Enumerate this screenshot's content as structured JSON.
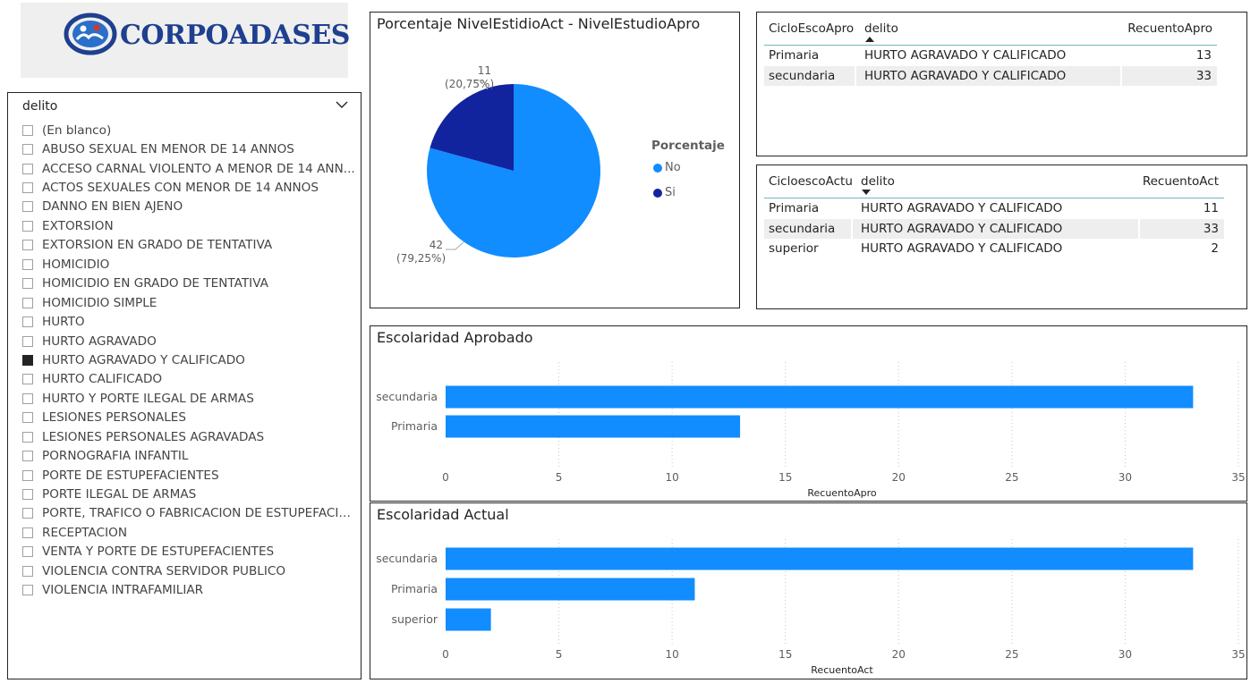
{
  "logo": {
    "text": "CORPOADASES"
  },
  "slicer": {
    "title": "delito",
    "items": [
      {
        "label": "(En blanco)",
        "selected": false
      },
      {
        "label": "ABUSO SEXUAL EN MENOR DE 14 ANNOS",
        "selected": false
      },
      {
        "label": "ACCESO CARNAL VIOLENTO A MENOR DE 14 ANN...",
        "selected": false
      },
      {
        "label": "ACTOS SEXUALES CON MENOR DE 14 ANNOS",
        "selected": false
      },
      {
        "label": "DANNO EN BIEN AJENO",
        "selected": false
      },
      {
        "label": "EXTORSION",
        "selected": false
      },
      {
        "label": "EXTORSION EN GRADO DE TENTATIVA",
        "selected": false
      },
      {
        "label": "HOMICIDIO",
        "selected": false
      },
      {
        "label": "HOMICIDIO EN GRADO DE TENTATIVA",
        "selected": false
      },
      {
        "label": "HOMICIDIO SIMPLE",
        "selected": false
      },
      {
        "label": "HURTO",
        "selected": false
      },
      {
        "label": "HURTO AGRAVADO",
        "selected": false
      },
      {
        "label": "HURTO AGRAVADO Y CALIFICADO",
        "selected": true
      },
      {
        "label": "HURTO CALIFICADO",
        "selected": false
      },
      {
        "label": "HURTO Y PORTE ILEGAL DE ARMAS",
        "selected": false
      },
      {
        "label": "LESIONES PERSONALES",
        "selected": false
      },
      {
        "label": "LESIONES PERSONALES AGRAVADAS",
        "selected": false
      },
      {
        "label": "PORNOGRAFIA INFANTIL",
        "selected": false
      },
      {
        "label": "PORTE DE ESTUPEFACIENTES",
        "selected": false
      },
      {
        "label": "PORTE ILEGAL DE ARMAS",
        "selected": false
      },
      {
        "label": "PORTE, TRAFICO O FABRICACION DE ESTUPEFACIEN...",
        "selected": false
      },
      {
        "label": "RECEPTACION",
        "selected": false
      },
      {
        "label": "VENTA Y PORTE DE ESTUPEFACIENTES",
        "selected": false
      },
      {
        "label": "VIOLENCIA CONTRA SERVIDOR PUBLICO",
        "selected": false
      },
      {
        "label": "VIOLENCIA INTRAFAMILIAR",
        "selected": false
      }
    ]
  },
  "table1": {
    "headers": [
      "CicloEscoApro",
      "delito",
      "RecuentoApro"
    ],
    "rows": [
      [
        "Primaria",
        "HURTO AGRAVADO Y CALIFICADO",
        "13"
      ],
      [
        "secundaria",
        "HURTO AGRAVADO Y CALIFICADO",
        "33"
      ]
    ]
  },
  "table2": {
    "headers": [
      "CicloescoActu",
      "delito",
      "RecuentoAct"
    ],
    "rows": [
      [
        "Primaria",
        "HURTO AGRAVADO Y CALIFICADO",
        "11"
      ],
      [
        "secundaria",
        "HURTO AGRAVADO Y CALIFICADO",
        "33"
      ],
      [
        "superior",
        "HURTO AGRAVADO Y CALIFICADO",
        "2"
      ]
    ]
  },
  "colors": {
    "light_blue": "#118dff",
    "dark_blue": "#12239e",
    "text": "#252423",
    "muted": "#605e5c"
  },
  "chart_data": [
    {
      "type": "pie",
      "title": "Porcentaje NivelEstidioAct - NivelEstudioApro",
      "legend_title": "Porcentaje",
      "legend_position": "right",
      "categories": [
        "No",
        "Si"
      ],
      "values": [
        42,
        11
      ],
      "data_labels": [
        "42",
        "(79,25%)",
        "11",
        "(20,75%)"
      ],
      "colors": [
        "#118dff",
        "#12239e"
      ]
    },
    {
      "type": "bar",
      "orientation": "horizontal",
      "title": "Escolaridad Aprobado",
      "categories": [
        "secundaria",
        "Primaria"
      ],
      "values": [
        33,
        13
      ],
      "xlabel": "RecuentoApro",
      "xlim": [
        0,
        35
      ],
      "ticks": [
        0,
        5,
        10,
        15,
        20,
        25,
        30,
        35
      ],
      "grid": true
    },
    {
      "type": "bar",
      "orientation": "horizontal",
      "title": "Escolaridad Actual",
      "categories": [
        "secundaria",
        "Primaria",
        "superior"
      ],
      "values": [
        33,
        11,
        2
      ],
      "xlabel": "RecuentoAct",
      "xlim": [
        0,
        35
      ],
      "ticks": [
        0,
        5,
        10,
        15,
        20,
        25,
        30,
        35
      ],
      "grid": true
    }
  ]
}
